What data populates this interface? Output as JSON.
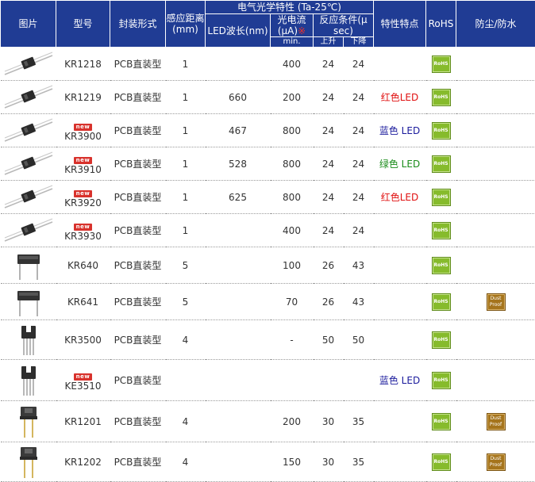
{
  "headers": {
    "image": "图片",
    "model": "型号",
    "package": "封装形式",
    "distance": "感应距离",
    "distance_unit": "(mm)",
    "electro_optical": "电气光学特性 (Ta-25℃)",
    "led_wavelength": "LED波长(nm)",
    "photocurrent": "光电流(μA)",
    "photocurrent_star": "※",
    "response": "反应条件(μ sec)",
    "min": "min.",
    "rise": "上升",
    "fall": "下降",
    "features": "特性特点",
    "rohs": "RoHS",
    "dustproof": "防尘/防水"
  },
  "badges": {
    "new": "new",
    "rohs": "RoHS",
    "dust_line1": "Dust",
    "dust_line2": "Proof"
  },
  "rows": [
    {
      "image": "slot-long",
      "new": false,
      "model": "KR1218",
      "package": "PCB直装型",
      "distance": "1",
      "wavelength": "",
      "photocurrent": "400",
      "rise": "24",
      "fall": "24",
      "feature_color": "",
      "feature_text": "",
      "rohs": true,
      "dust": false
    },
    {
      "image": "slot-long",
      "new": false,
      "model": "KR1219",
      "package": "PCB直装型",
      "distance": "1",
      "wavelength": "660",
      "photocurrent": "200",
      "rise": "24",
      "fall": "24",
      "feature_color": "",
      "feature_text": "红色LED",
      "rohs": true,
      "dust": false
    },
    {
      "image": "slot-long",
      "new": true,
      "model": "KR3900",
      "package": "PCB直装型",
      "distance": "1",
      "wavelength": "467",
      "photocurrent": "800",
      "rise": "24",
      "fall": "24",
      "feature_color": "蓝色",
      "feature_text": "LED",
      "rohs": true,
      "dust": false
    },
    {
      "image": "slot-long",
      "new": true,
      "model": "KR3910",
      "package": "PCB直装型",
      "distance": "1",
      "wavelength": "528",
      "photocurrent": "800",
      "rise": "24",
      "fall": "24",
      "feature_color": "绿色",
      "feature_text": "LED",
      "rohs": true,
      "dust": false
    },
    {
      "image": "slot-long",
      "new": true,
      "model": "KR3920",
      "package": "PCB直装型",
      "distance": "1",
      "wavelength": "625",
      "photocurrent": "800",
      "rise": "24",
      "fall": "24",
      "feature_color": "",
      "feature_text": "红色LED",
      "rohs": true,
      "dust": false
    },
    {
      "image": "slot-long",
      "new": true,
      "model": "KR3930",
      "package": "PCB直装型",
      "distance": "1",
      "wavelength": "",
      "photocurrent": "400",
      "rise": "24",
      "fall": "24",
      "feature_color": "",
      "feature_text": "",
      "rohs": true,
      "dust": false
    },
    {
      "image": "block-wide",
      "new": false,
      "model": "KR640",
      "package": "PCB直装型",
      "distance": "5",
      "wavelength": "",
      "photocurrent": "100",
      "rise": "26",
      "fall": "43",
      "feature_color": "",
      "feature_text": "",
      "rohs": true,
      "dust": false
    },
    {
      "image": "block-wide",
      "new": false,
      "model": "KR641",
      "package": "PCB直装型",
      "distance": "5",
      "wavelength": "",
      "photocurrent": "70",
      "rise": "26",
      "fall": "43",
      "feature_color": "",
      "feature_text": "",
      "rohs": true,
      "dust": true
    },
    {
      "image": "slot-small",
      "new": false,
      "model": "KR3500",
      "package": "PCB直装型",
      "distance": "4",
      "wavelength": "",
      "photocurrent": "-",
      "rise": "50",
      "fall": "50",
      "feature_color": "",
      "feature_text": "",
      "rohs": true,
      "dust": false
    },
    {
      "image": "slot-small",
      "new": true,
      "model": "KE3510",
      "package": "PCB直装型",
      "distance": "",
      "wavelength": "",
      "photocurrent": "",
      "rise": "",
      "fall": "",
      "feature_color": "蓝色",
      "feature_text": "LED",
      "rohs": true,
      "dust": false
    },
    {
      "image": "slot-gold",
      "new": false,
      "model": "KR1201",
      "package": "PCB直装型",
      "distance": "4",
      "wavelength": "",
      "photocurrent": "200",
      "rise": "30",
      "fall": "35",
      "feature_color": "",
      "feature_text": "",
      "rohs": true,
      "dust": true
    },
    {
      "image": "slot-gold",
      "new": false,
      "model": "KR1202",
      "package": "PCB直装型",
      "distance": "4",
      "wavelength": "",
      "photocurrent": "150",
      "rise": "30",
      "fall": "35",
      "feature_color": "",
      "feature_text": "",
      "rohs": true,
      "dust": true
    }
  ]
}
